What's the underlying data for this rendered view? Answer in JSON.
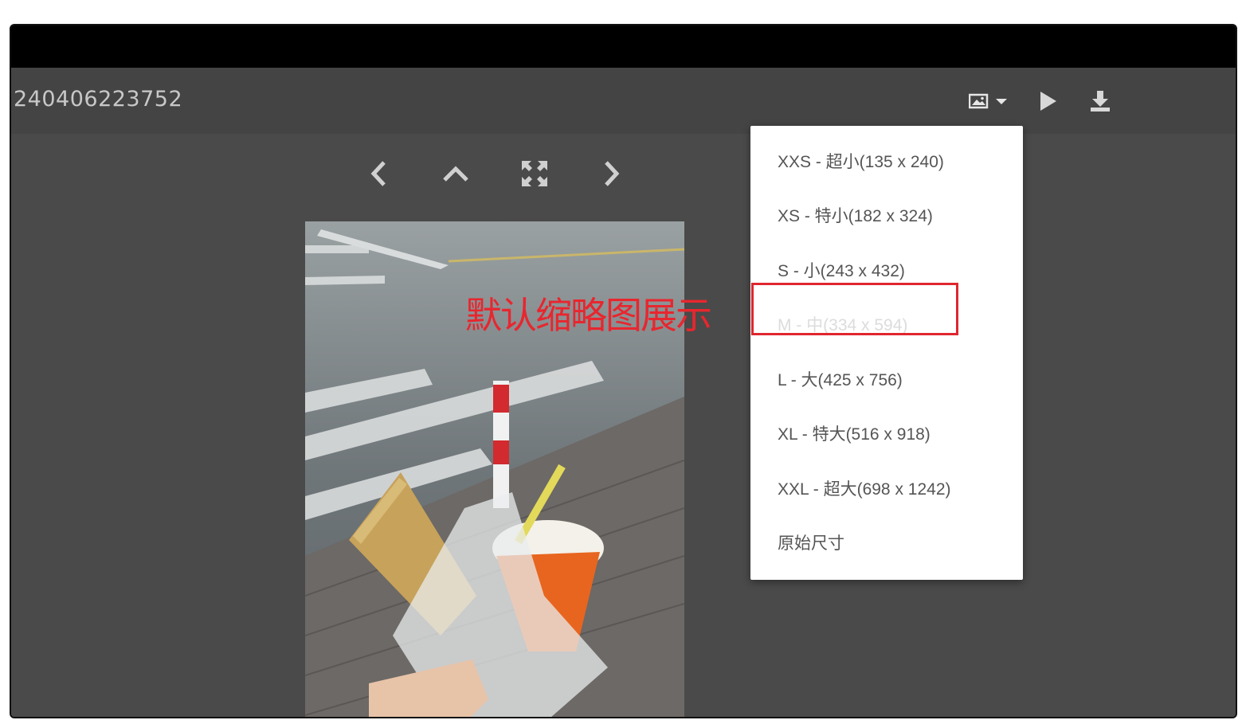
{
  "header": {
    "title": "240406223752"
  },
  "toolbar": {
    "icons": [
      "image-icon",
      "caret-down-icon",
      "play-icon",
      "download-icon"
    ]
  },
  "navigation": {
    "icons": [
      "chevron-left-icon",
      "chevron-up-icon",
      "expand-icon",
      "chevron-right-icon"
    ]
  },
  "size_menu": {
    "items": [
      {
        "label": "XXS - 超小(135 x 240)",
        "active": false
      },
      {
        "label": "XS - 特小(182 x 324)",
        "active": false
      },
      {
        "label": "S - 小(243 x 432)",
        "active": false
      },
      {
        "label": "M - 中(334 x 594)",
        "active": true
      },
      {
        "label": "L - 大(425 x 756)",
        "active": false
      },
      {
        "label": "XL - 特大(516 x 918)",
        "active": false
      },
      {
        "label": "XXL - 超大(698 x 1242)",
        "active": false
      },
      {
        "label": "原始尺寸",
        "active": false
      }
    ]
  },
  "annotation": {
    "text": "默认缩略图展示",
    "color": "#e8262e"
  },
  "colors": {
    "background": "#4a4a4a",
    "topbar": "#444444",
    "title_text": "#c8c8c8",
    "icon": "#d8d8d8"
  }
}
